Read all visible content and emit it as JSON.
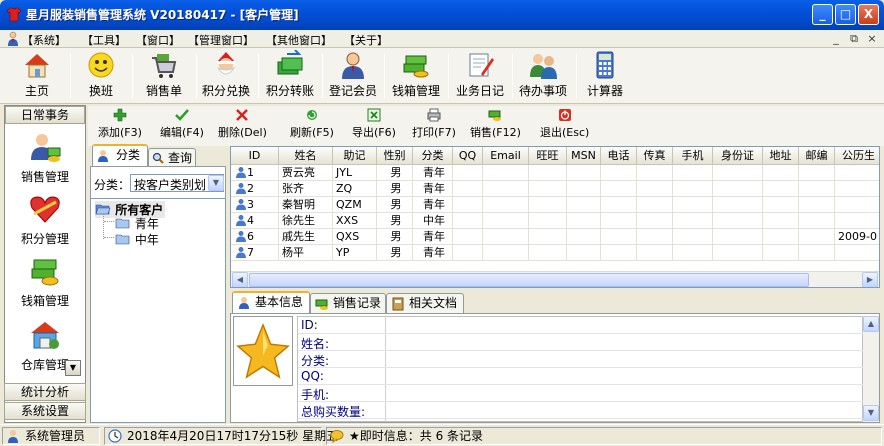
{
  "window": {
    "title": "星月服装销售管理系统 V20180417 - [客户管理]",
    "controls": {
      "minimize": "_",
      "maximize": "□",
      "close": "X"
    }
  },
  "menu": {
    "items": [
      "【系统】",
      "【工具】",
      "【窗口】",
      "【管理窗口】",
      "【其他窗口】",
      "【关于】"
    ],
    "mdi_controls": [
      "_",
      "⧉",
      "×"
    ]
  },
  "toolbar": {
    "items": [
      "主页",
      "换班",
      "销售单",
      "积分兑换",
      "积分转账",
      "登记会员",
      "钱箱管理",
      "业务日记",
      "待办事项",
      "计算器"
    ]
  },
  "leftnav": {
    "header": "日常事务",
    "items": [
      "销售管理",
      "积分管理",
      "钱箱管理",
      "仓库管理"
    ],
    "footer": [
      "统计分析",
      "系统设置"
    ]
  },
  "actions": {
    "items": [
      "添加(F3)",
      "编辑(F4)",
      "删除(Del)",
      "刷新(F5)",
      "导出(F6)",
      "打印(F7)",
      "销售(F12)",
      "退出(Esc)"
    ]
  },
  "tree": {
    "tabs": [
      "分类",
      "查询"
    ],
    "filter_label": "分类：",
    "filter_value": "按客户类别划",
    "root": "所有客户",
    "children": [
      "青年",
      "中年"
    ]
  },
  "grid": {
    "columns": [
      "ID",
      "姓名",
      "助记",
      "性别",
      "分类",
      "QQ",
      "Email",
      "旺旺",
      "MSN",
      "电话",
      "传真",
      "手机",
      "身份证",
      "地址",
      "邮编",
      "公历生"
    ],
    "rows": [
      {
        "id": "1",
        "name": "贾云亮",
        "code": "JYL",
        "sex": "男",
        "cat": "青年",
        "bday": ""
      },
      {
        "id": "2",
        "name": "张齐",
        "code": "ZQ",
        "sex": "男",
        "cat": "青年",
        "bday": ""
      },
      {
        "id": "3",
        "name": "秦智明",
        "code": "QZM",
        "sex": "男",
        "cat": "青年",
        "bday": ""
      },
      {
        "id": "4",
        "name": "徐先生",
        "code": "XXS",
        "sex": "男",
        "cat": "中年",
        "bday": ""
      },
      {
        "id": "6",
        "name": "戚先生",
        "code": "QXS",
        "sex": "男",
        "cat": "青年",
        "bday": "2009-0"
      },
      {
        "id": "7",
        "name": "杨平",
        "code": "YP",
        "sex": "男",
        "cat": "青年",
        "bday": ""
      }
    ]
  },
  "detail": {
    "tabs": [
      "基本信息",
      "销售记录",
      "相关文档"
    ],
    "fields": [
      "ID:",
      "姓名:",
      "分类:",
      "QQ:",
      "手机:",
      "总购买数量:"
    ]
  },
  "status": {
    "user": "系统管理员",
    "datetime": "2018年4月20日17时17分15秒 星期五",
    "message": "★即时信息：共 6 条记录"
  },
  "colors": {
    "titlebar": "#0550d8",
    "tab_accent": "#f0b030",
    "field_label": "#000080"
  }
}
